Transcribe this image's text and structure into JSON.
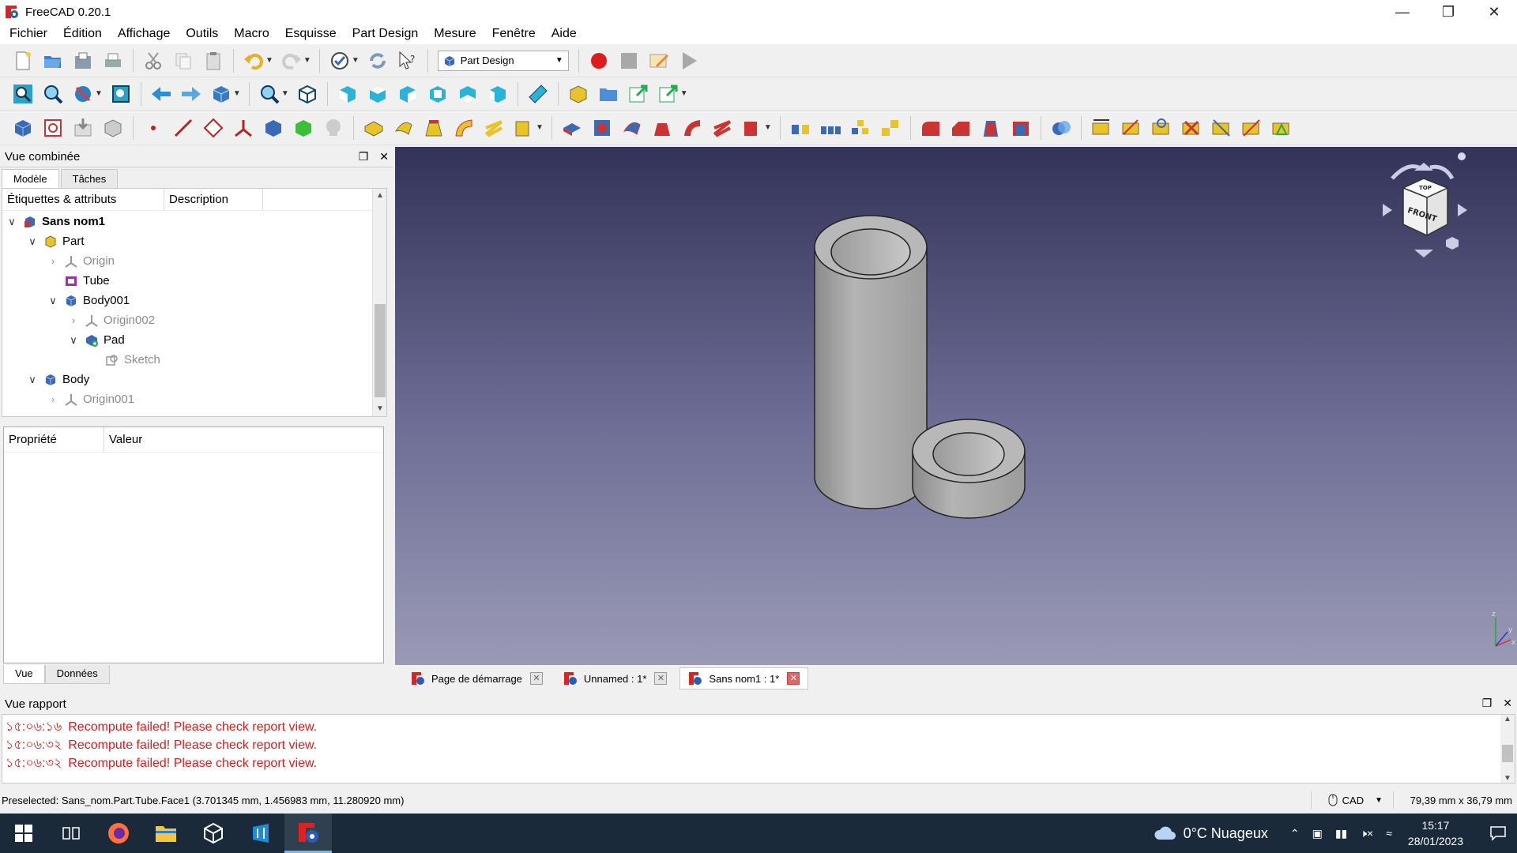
{
  "window": {
    "title": "FreeCAD 0.20.1"
  },
  "menu": [
    "Fichier",
    "Édition",
    "Affichage",
    "Outils",
    "Macro",
    "Esquisse",
    "Part Design",
    "Mesure",
    "Fenêtre",
    "Aide"
  ],
  "workbench": {
    "selected": "Part Design"
  },
  "combo": {
    "title": "Vue combinée",
    "tabs": [
      "Modèle",
      "Tâches"
    ],
    "tree_columns": [
      "Étiquettes & attributs",
      "Description"
    ],
    "tree": [
      {
        "label": "Sans nom1",
        "bold": true
      },
      {
        "label": "Part"
      },
      {
        "label": "Origin",
        "gray": true
      },
      {
        "label": "Tube"
      },
      {
        "label": "Body001"
      },
      {
        "label": "Origin002",
        "gray": true
      },
      {
        "label": "Pad"
      },
      {
        "label": "Sketch",
        "gray": true
      },
      {
        "label": "Body"
      },
      {
        "label": "Origin001",
        "gray": true
      }
    ],
    "prop_columns": [
      "Propriété",
      "Valeur"
    ],
    "bottom_tabs": [
      "Vue",
      "Données"
    ]
  },
  "doc_tabs": [
    {
      "label": "Page de démarrage"
    },
    {
      "label": "Unnamed : 1*"
    },
    {
      "label": "Sans nom1 : 1*",
      "active": true
    }
  ],
  "report": {
    "title": "Vue rapport",
    "lines": [
      {
        "ts": "১৫:০৬:১৬",
        "msg": "Recompute failed! Please check report view."
      },
      {
        "ts": "১৫:০৬:৩২",
        "msg": "Recompute failed! Please check report view."
      },
      {
        "ts": "১৫:০৬:৩২",
        "msg": "Recompute failed! Please check report view."
      }
    ]
  },
  "status": {
    "preselected": "Preselected: Sans_nom.Part.Tube.Face1 (3.701345 mm, 1.456983 mm, 11.280920 mm)",
    "nav_style": "CAD",
    "dimensions": "79,39 mm x 36,79 mm"
  },
  "taskbar": {
    "weather": "0°C  Nuageux",
    "time": "15:17",
    "date": "28/01/2023"
  },
  "navcube": {
    "face_label": "FRONT",
    "top_label": "TOP"
  },
  "colors": {
    "viewport_top": "#33335a",
    "viewport_bottom": "#9a9ab6",
    "error_text": "#e01b1b",
    "taskbar": "#1b2a3a"
  }
}
